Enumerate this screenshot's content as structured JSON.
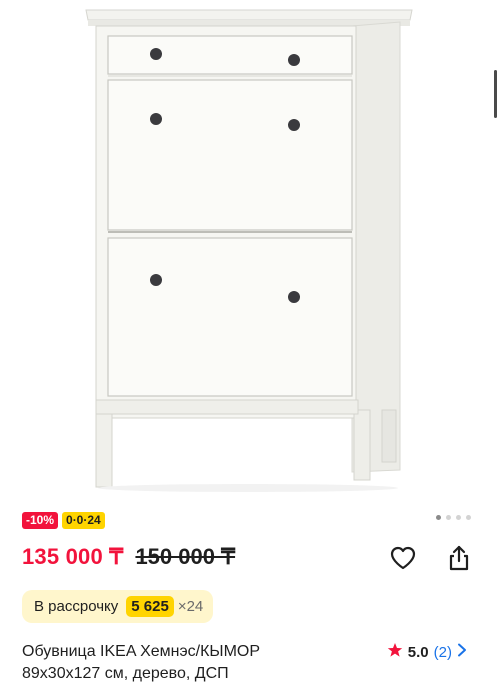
{
  "product": {
    "image_alt": "white shoe cabinet",
    "badges": {
      "discount": "-10%",
      "installment": "0·0·24"
    },
    "gallery": {
      "total_dots": 4,
      "active_index": 0
    },
    "price": {
      "current": "135 000 ₸",
      "old": "150 000 ₸"
    },
    "installment": {
      "label": "В рассрочку",
      "amount": "5 625",
      "months": "×24"
    },
    "title_line1": "Обувница IKEA Хемнэс/КЫМОР",
    "title_line2": "89х30х127 см, дерево, ДСП",
    "rating": {
      "value": "5.0",
      "count": "(2)"
    }
  },
  "colors": {
    "discount_red": "#f2133c",
    "installment_yellow": "#ffd400",
    "installment_bg": "#fff6cc",
    "link_blue": "#1a73e8"
  },
  "icons": {
    "favorite": "heart-icon",
    "share": "share-icon",
    "rating": "star-icon",
    "more": "chevron-right-icon"
  }
}
